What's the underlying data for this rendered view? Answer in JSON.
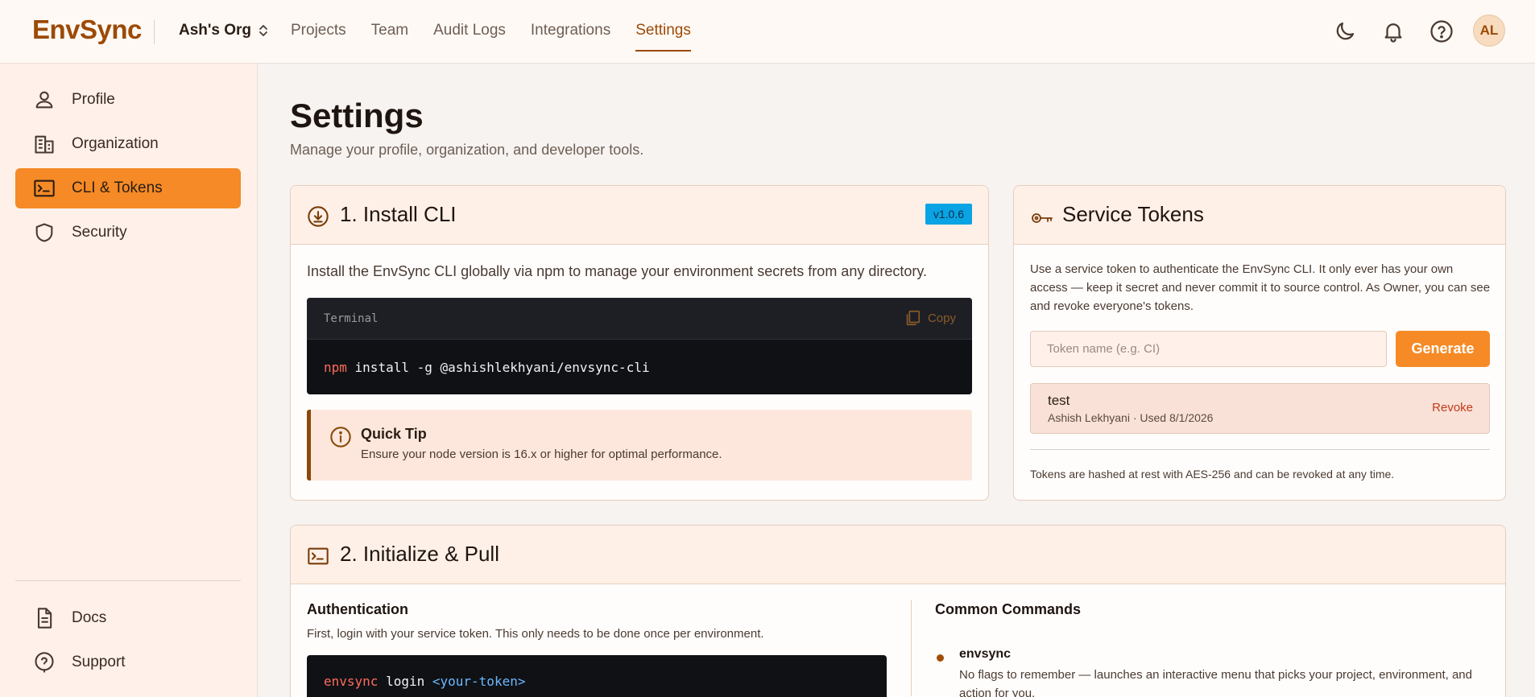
{
  "app": {
    "logo": "EnvSync",
    "org": "Ash's Org",
    "avatar": "AL"
  },
  "nav": [
    {
      "label": "Projects"
    },
    {
      "label": "Team"
    },
    {
      "label": "Audit Logs"
    },
    {
      "label": "Integrations"
    },
    {
      "label": "Settings",
      "active": true
    }
  ],
  "sidebar": {
    "items": [
      {
        "label": "Profile",
        "icon": "user-icon"
      },
      {
        "label": "Organization",
        "icon": "building-icon"
      },
      {
        "label": "CLI & Tokens",
        "icon": "terminal-icon",
        "active": true
      },
      {
        "label": "Security",
        "icon": "shield-icon"
      }
    ],
    "bottom": [
      {
        "label": "Docs",
        "icon": "document-icon"
      },
      {
        "label": "Support",
        "icon": "help-icon"
      }
    ]
  },
  "page": {
    "title": "Settings",
    "subtitle": "Manage your profile, organization, and developer tools."
  },
  "install": {
    "title": "1. Install CLI",
    "version": "v1.0.6",
    "description": "Install the EnvSync CLI globally via npm to manage your environment secrets from any directory.",
    "terminal_label": "Terminal",
    "copy_label": "Copy",
    "cmd_keyword": "npm",
    "cmd_rest": " install -g @ashishlekhyani/envsync-cli",
    "tip_title": "Quick Tip",
    "tip_text": "Ensure your node version is 16.x or higher for optimal performance."
  },
  "tokens": {
    "title": "Service Tokens",
    "description": "Use a service token to authenticate the EnvSync CLI. It only ever has your own access — keep it secret and never commit it to source control. As Owner, you can see and revoke everyone's tokens.",
    "input_placeholder": "Token name (e.g. CI)",
    "generate_label": "Generate",
    "list": [
      {
        "name": "test",
        "meta": "Ashish Lekhyani · Used 8/1/2026",
        "action": "Revoke"
      }
    ],
    "footer": "Tokens are hashed at rest with AES-256 and can be revoked at any time."
  },
  "init": {
    "title": "2. Initialize & Pull",
    "auth_heading": "Authentication",
    "auth_text": "First, login with your service token. This only needs to be done once per environment.",
    "login_keyword": "envsync",
    "login_cmd": " login ",
    "login_arg": "<your-token>",
    "commands_heading": "Common Commands",
    "commands": [
      {
        "name": "envsync",
        "description": "No flags to remember — launches an interactive menu that picks your project, environment, and action for you."
      }
    ]
  },
  "colors": {
    "accent": "#f58a26",
    "brand": "#9c4a06",
    "badge": "#0aa3e4"
  }
}
